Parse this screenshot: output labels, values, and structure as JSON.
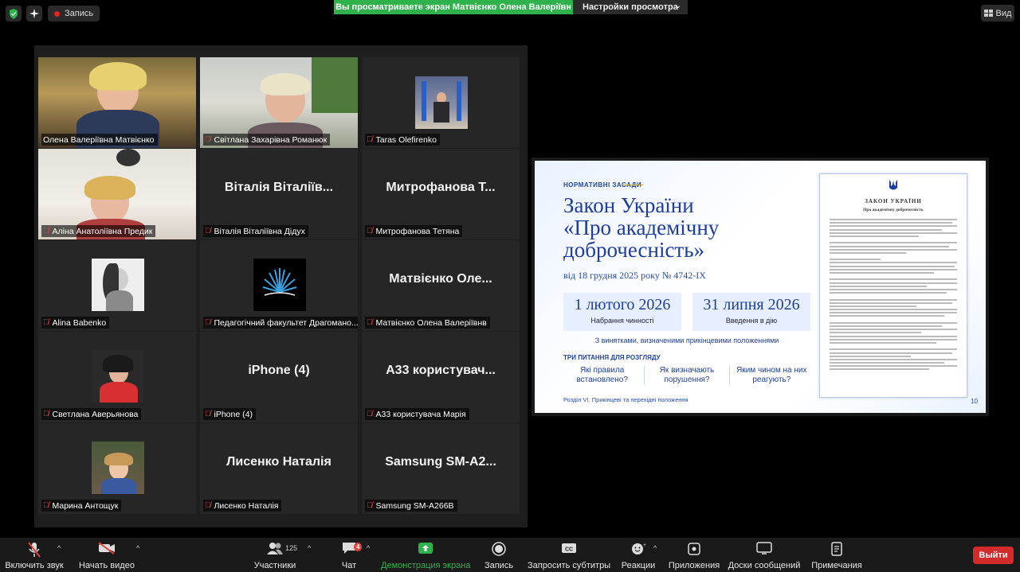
{
  "top": {
    "record_label": "Запись",
    "share_banner": "Вы просматриваете экран Матвієнко Олена Валеріївн",
    "view_settings": "Настройки просмотра",
    "view_button": "Вид"
  },
  "participants": [
    {
      "name": "Олена Валеріївна Матвієнко",
      "big": "",
      "video": true,
      "muted": false,
      "active": true
    },
    {
      "name": "Світлана Захарівна Романюк",
      "big": "",
      "video": true,
      "muted": true
    },
    {
      "name": "Taras Olefirenko",
      "big": "",
      "video": true,
      "muted": true
    },
    {
      "name": "Аліна Анатоліївна Предик",
      "big": "",
      "video": true,
      "muted": true
    },
    {
      "name": "Віталія Віталіївна Дідух",
      "big": "Віталія Віталіїв...",
      "video": false,
      "muted": true
    },
    {
      "name": "Митрофанова Тетяна",
      "big": "Митрофанова Т...",
      "video": false,
      "muted": true
    },
    {
      "name": "Alina Babenko",
      "big": "",
      "video": true,
      "muted": true
    },
    {
      "name": "Педагогічний факультет Драгомано...",
      "big": "",
      "video": true,
      "muted": true
    },
    {
      "name": "Матвієнко Олена Валеріївнв",
      "big": "Матвієнко Оле...",
      "video": false,
      "muted": true
    },
    {
      "name": "Светлана Аверьянова",
      "big": "",
      "video": true,
      "muted": true
    },
    {
      "name": "iPhone (4)",
      "big": "iPhone (4)",
      "video": false,
      "muted": true
    },
    {
      "name": "A33 користувача Марія",
      "big": "A33 користувач...",
      "video": false,
      "muted": true
    },
    {
      "name": "Марина Антощук",
      "big": "",
      "video": true,
      "muted": true
    },
    {
      "name": "Лисенко Наталія",
      "big": "Лисенко Наталія",
      "video": false,
      "muted": true
    },
    {
      "name": "Samsung SM-A266B",
      "big": "Samsung SM-A2...",
      "video": false,
      "muted": true
    }
  ],
  "slide": {
    "category": "НОРМАТИВНІ ЗАСАДИ",
    "title_line1": "Закон України",
    "title_line2": "«Про академічну",
    "title_line3": "доброчесність»",
    "date": "від 18 грудня 2025 року № 4742-IX",
    "box1_date": "1 лютого 2026",
    "box1_label": "Набрання чинності",
    "box2_date": "31 липня 2026",
    "box2_label": "Введення в дію",
    "note": "З винятками, визначеними прикінцевими положеннями",
    "questions_title": "ТРИ ПИТАННЯ ДЛЯ РОЗГЛЯДУ",
    "q1": "Які правила встановлено?",
    "q2": "Як визначають порушення?",
    "q3": "Яким чином на них реагують?",
    "footer": "Розділ VI. Прикінцеві та перехідні положення",
    "page": "10",
    "doc_title": "ЗАКОН УКРАЇНИ",
    "doc_subtitle": "Про академічну доброчесність"
  },
  "toolbar": {
    "mute": "Включить звук",
    "video": "Начать видео",
    "participants": "Участники",
    "participants_count": "125",
    "chat": "Чат",
    "chat_badge": "4",
    "share": "Демонстрация экрана",
    "record": "Запись",
    "captions": "Запросить субтитры",
    "reactions": "Реакции",
    "apps": "Приложения",
    "whiteboards": "Доски сообщений",
    "notes": "Примечания",
    "leave": "Выйти"
  },
  "colors": {
    "share_green": "#2fb24c",
    "leave_red": "#d32b2b",
    "active_speaker": "#e8e06a",
    "slide_blue": "#1e3d9c"
  }
}
